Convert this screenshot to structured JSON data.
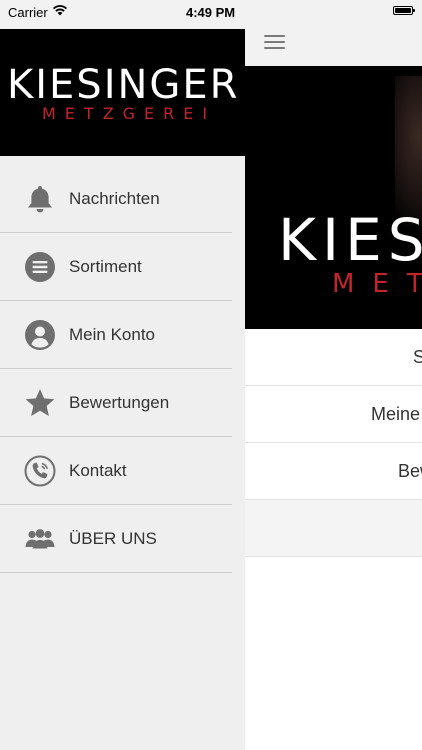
{
  "status_bar": {
    "carrier": "Carrier",
    "time": "4:49 PM"
  },
  "brand": {
    "name": "KIESINGER",
    "tagline": "METZGEREI",
    "accent_color": "#c2242c"
  },
  "drawer": {
    "menu": [
      {
        "label": "Nachrichten",
        "icon": "bell-icon"
      },
      {
        "label": "Sortiment",
        "icon": "list-icon"
      },
      {
        "label": "Mein Konto",
        "icon": "user-icon"
      },
      {
        "label": "Bewertungen",
        "icon": "star-icon"
      },
      {
        "label": "Kontakt",
        "icon": "phone-icon"
      },
      {
        "label": "ÜBER UNS",
        "icon": "group-icon"
      }
    ]
  },
  "main": {
    "banner_title": "KIES",
    "banner_sub": "MET",
    "list": [
      "S",
      "Meine",
      "Bew",
      ""
    ]
  }
}
